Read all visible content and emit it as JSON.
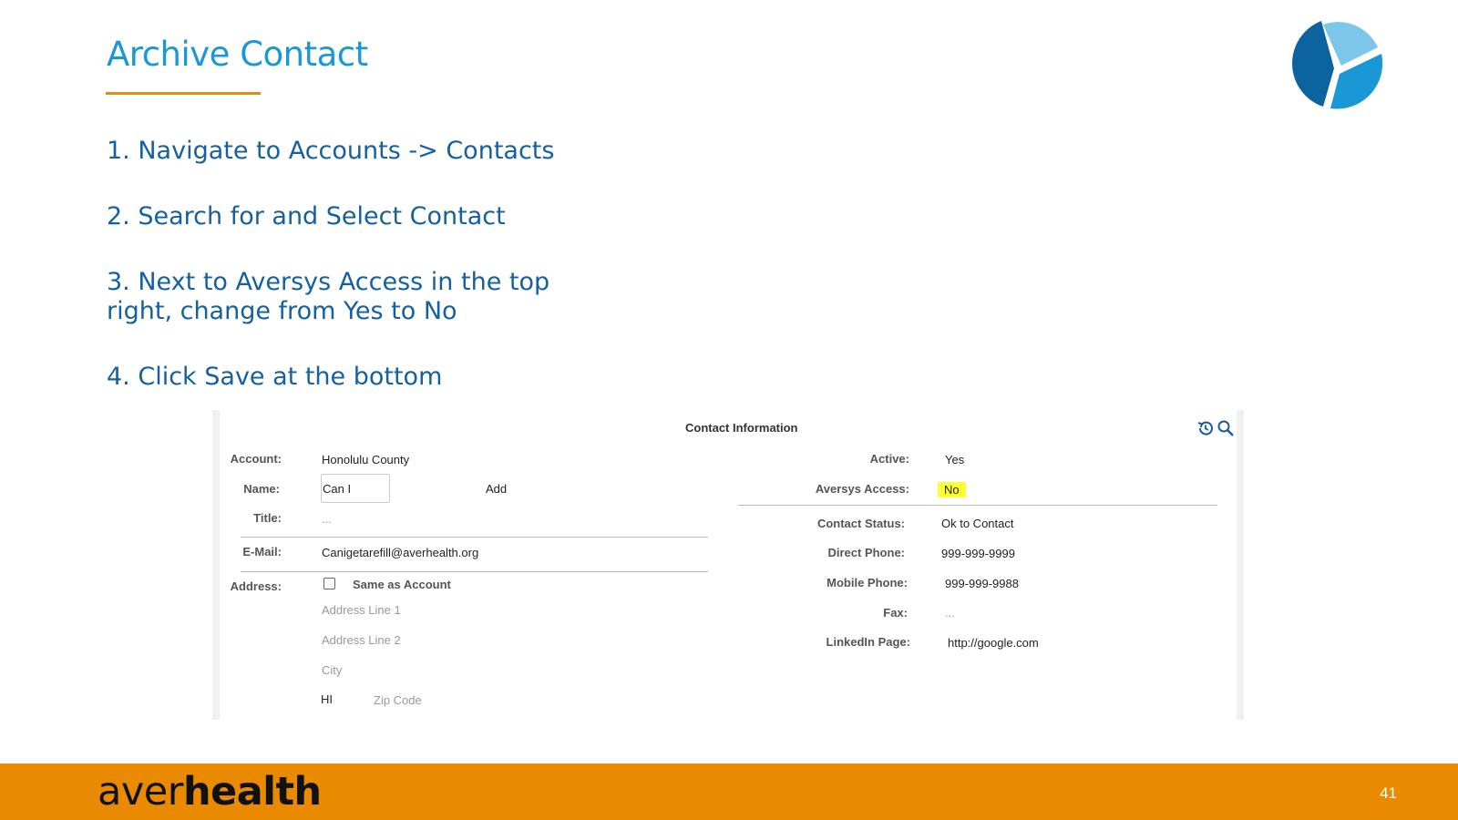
{
  "slide": {
    "title": "Archive Contact",
    "steps": [
      "1. Navigate to Accounts -> Contacts",
      "2. Search for and Select Contact",
      "3. Next to Aversys Access in the top",
      "right, change from Yes to No",
      "4. Click Save at the bottom"
    ]
  },
  "panel": {
    "header": "Contact Information",
    "left": {
      "account_label": "Account:",
      "account_value": "Honolulu County",
      "name_label": "Name:",
      "name_value": "Can I",
      "add_label": "Add",
      "title_label": "Title:",
      "title_value": "...",
      "email_label": "E-Mail:",
      "email_value": "Canigetarefill@averhealth.org",
      "address_label": "Address:",
      "same_as_account": "Same as Account",
      "address_line1": "Address Line 1",
      "address_line2": "Address Line 2",
      "city": "City",
      "state": "HI",
      "zip": "Zip Code"
    },
    "right": {
      "active_label": "Active:",
      "active_value": "Yes",
      "access_label": "Aversys Access:",
      "access_value": "No",
      "status_label": "Contact Status:",
      "status_value": "Ok to Contact",
      "direct_label": "Direct Phone:",
      "direct_value": "999-999-9999",
      "mobile_label": "Mobile Phone:",
      "mobile_value": "999-999-9988",
      "fax_label": "Fax:",
      "fax_value": "...",
      "linkedin_label": "LinkedIn Page:",
      "linkedin_value": "http://google.com"
    }
  },
  "footer": {
    "brand_light": "aver",
    "brand_bold": "health",
    "page_number": "41"
  },
  "colors": {
    "title": "#1a98d5",
    "steps": "#1560a0",
    "accent": "#ea8a00",
    "highlight": "#ffff33"
  },
  "icons": [
    "logo-icon",
    "history-icon",
    "search-icon",
    "checkbox"
  ]
}
